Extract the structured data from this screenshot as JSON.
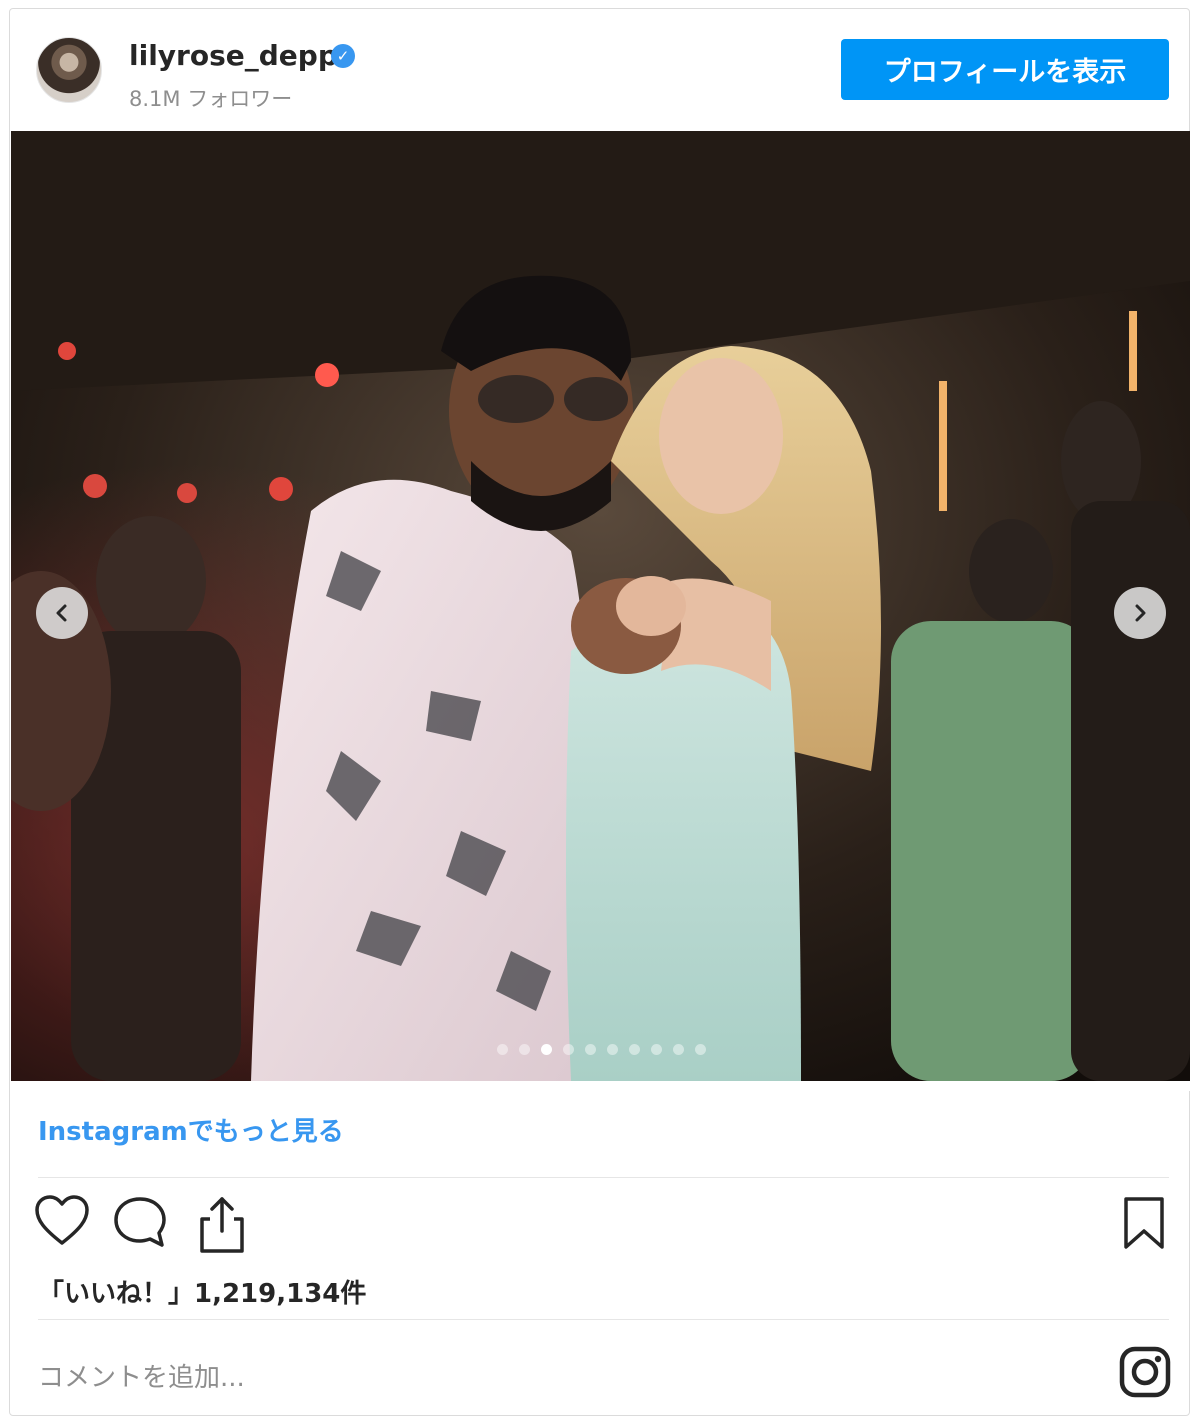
{
  "header": {
    "username": "lilyrose_depp",
    "verified_mark": "✓",
    "followers": "8.1M フォロワー",
    "profile_button": "プロフィールを表示"
  },
  "carousel": {
    "slide_count": 10,
    "active_index": 2
  },
  "footer": {
    "more_link": "Instagramでもっと見る",
    "likes": "「いいね！」1,219,134件",
    "comment_placeholder": "コメントを追加..."
  },
  "icons": {
    "like": "heart-icon",
    "comment": "comment-icon",
    "share": "share-icon",
    "save": "bookmark-icon",
    "brand": "instagram-icon",
    "prev": "chevron-left-icon",
    "next": "chevron-right-icon"
  },
  "colors": {
    "accent": "#0095f6",
    "link": "#3897f0",
    "muted": "#8e8e8e"
  }
}
